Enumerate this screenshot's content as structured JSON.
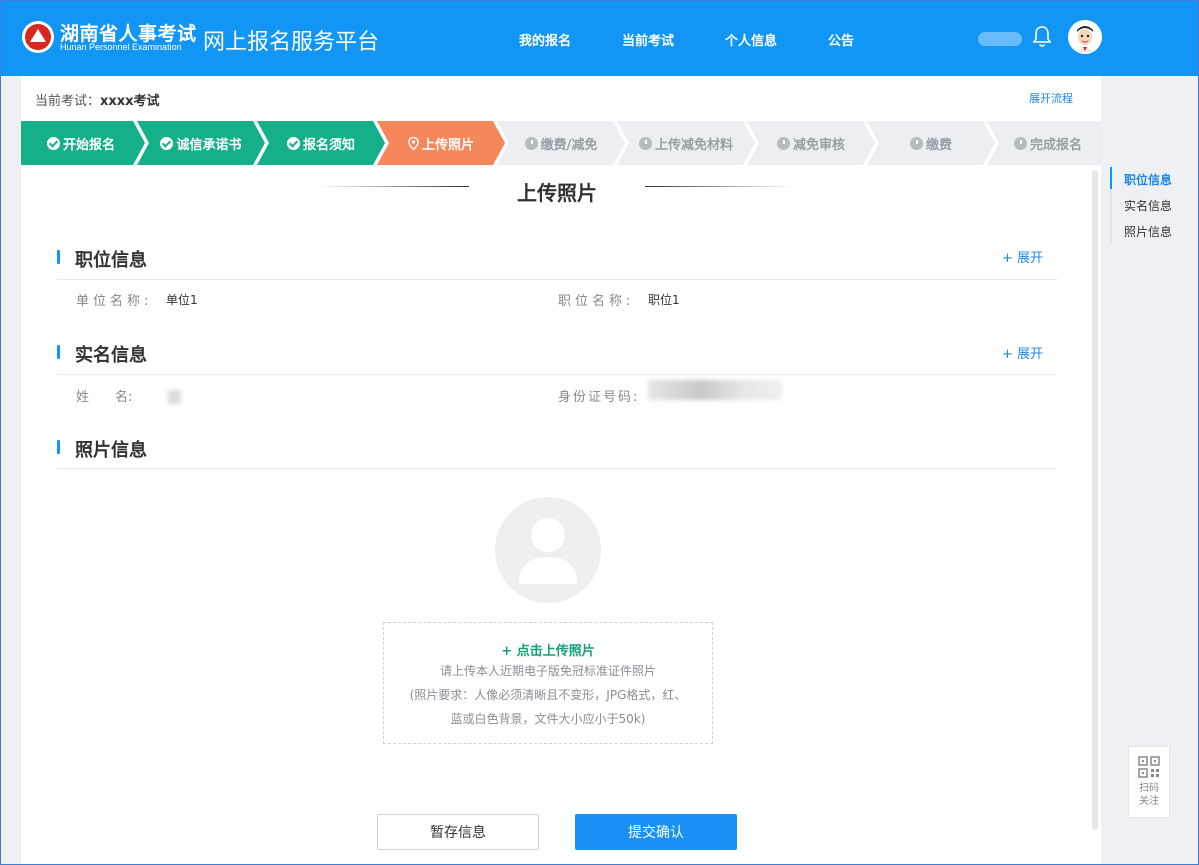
{
  "header": {
    "logo_title": "湖南省人事考试",
    "logo_sub": "Hunan Personnel Examination",
    "platform_title": "网上报名服务平台",
    "nav": [
      "我的报名",
      "当前考试",
      "个人信息",
      "公告"
    ],
    "brand_color": "#1296f5"
  },
  "exam_bar": {
    "label": "当前考试：",
    "value": "xxxx考试",
    "expand_flow": "展开流程"
  },
  "steps": [
    {
      "label": "开始报名",
      "status": "done"
    },
    {
      "label": "诚信承诺书",
      "status": "done"
    },
    {
      "label": "报名须知",
      "status": "done"
    },
    {
      "label": "上传照片",
      "status": "active"
    },
    {
      "label": "缴费/减免",
      "status": "todo"
    },
    {
      "label": "上传减免材料",
      "status": "todo"
    },
    {
      "label": "减免审核",
      "status": "todo"
    },
    {
      "label": "缴费",
      "status": "todo"
    },
    {
      "label": "完成报名",
      "status": "todo"
    }
  ],
  "step_colors": {
    "done": "#14b08a",
    "active": "#f5875a",
    "todo": "#eceef1"
  },
  "page_title": "上传照片",
  "sections": {
    "position": {
      "title": "职位信息",
      "expand": "+ 展开",
      "unit_label": "单位名称:",
      "unit_value": "单位1",
      "post_label": "职位名称:",
      "post_value": "职位1"
    },
    "realname": {
      "title": "实名信息",
      "expand": "+ 展开",
      "name_label": "姓　　名:",
      "id_label": "身份证号码:"
    },
    "photo": {
      "title": "照片信息",
      "upload_link": "+ 点击上传照片",
      "hint_1": "请上传本人近期电子版免冠标准证件照片",
      "hint_2": "(照片要求：人像必须清晰且不变形，JPG格式，红、",
      "hint_3": "蓝或白色背景，文件大小应小于50k)"
    }
  },
  "buttons": {
    "save": "暂存信息",
    "submit": "提交确认"
  },
  "anchor_nav": [
    "职位信息",
    "实名信息",
    "照片信息"
  ],
  "qr": {
    "line1": "扫码",
    "line2": "关注"
  }
}
